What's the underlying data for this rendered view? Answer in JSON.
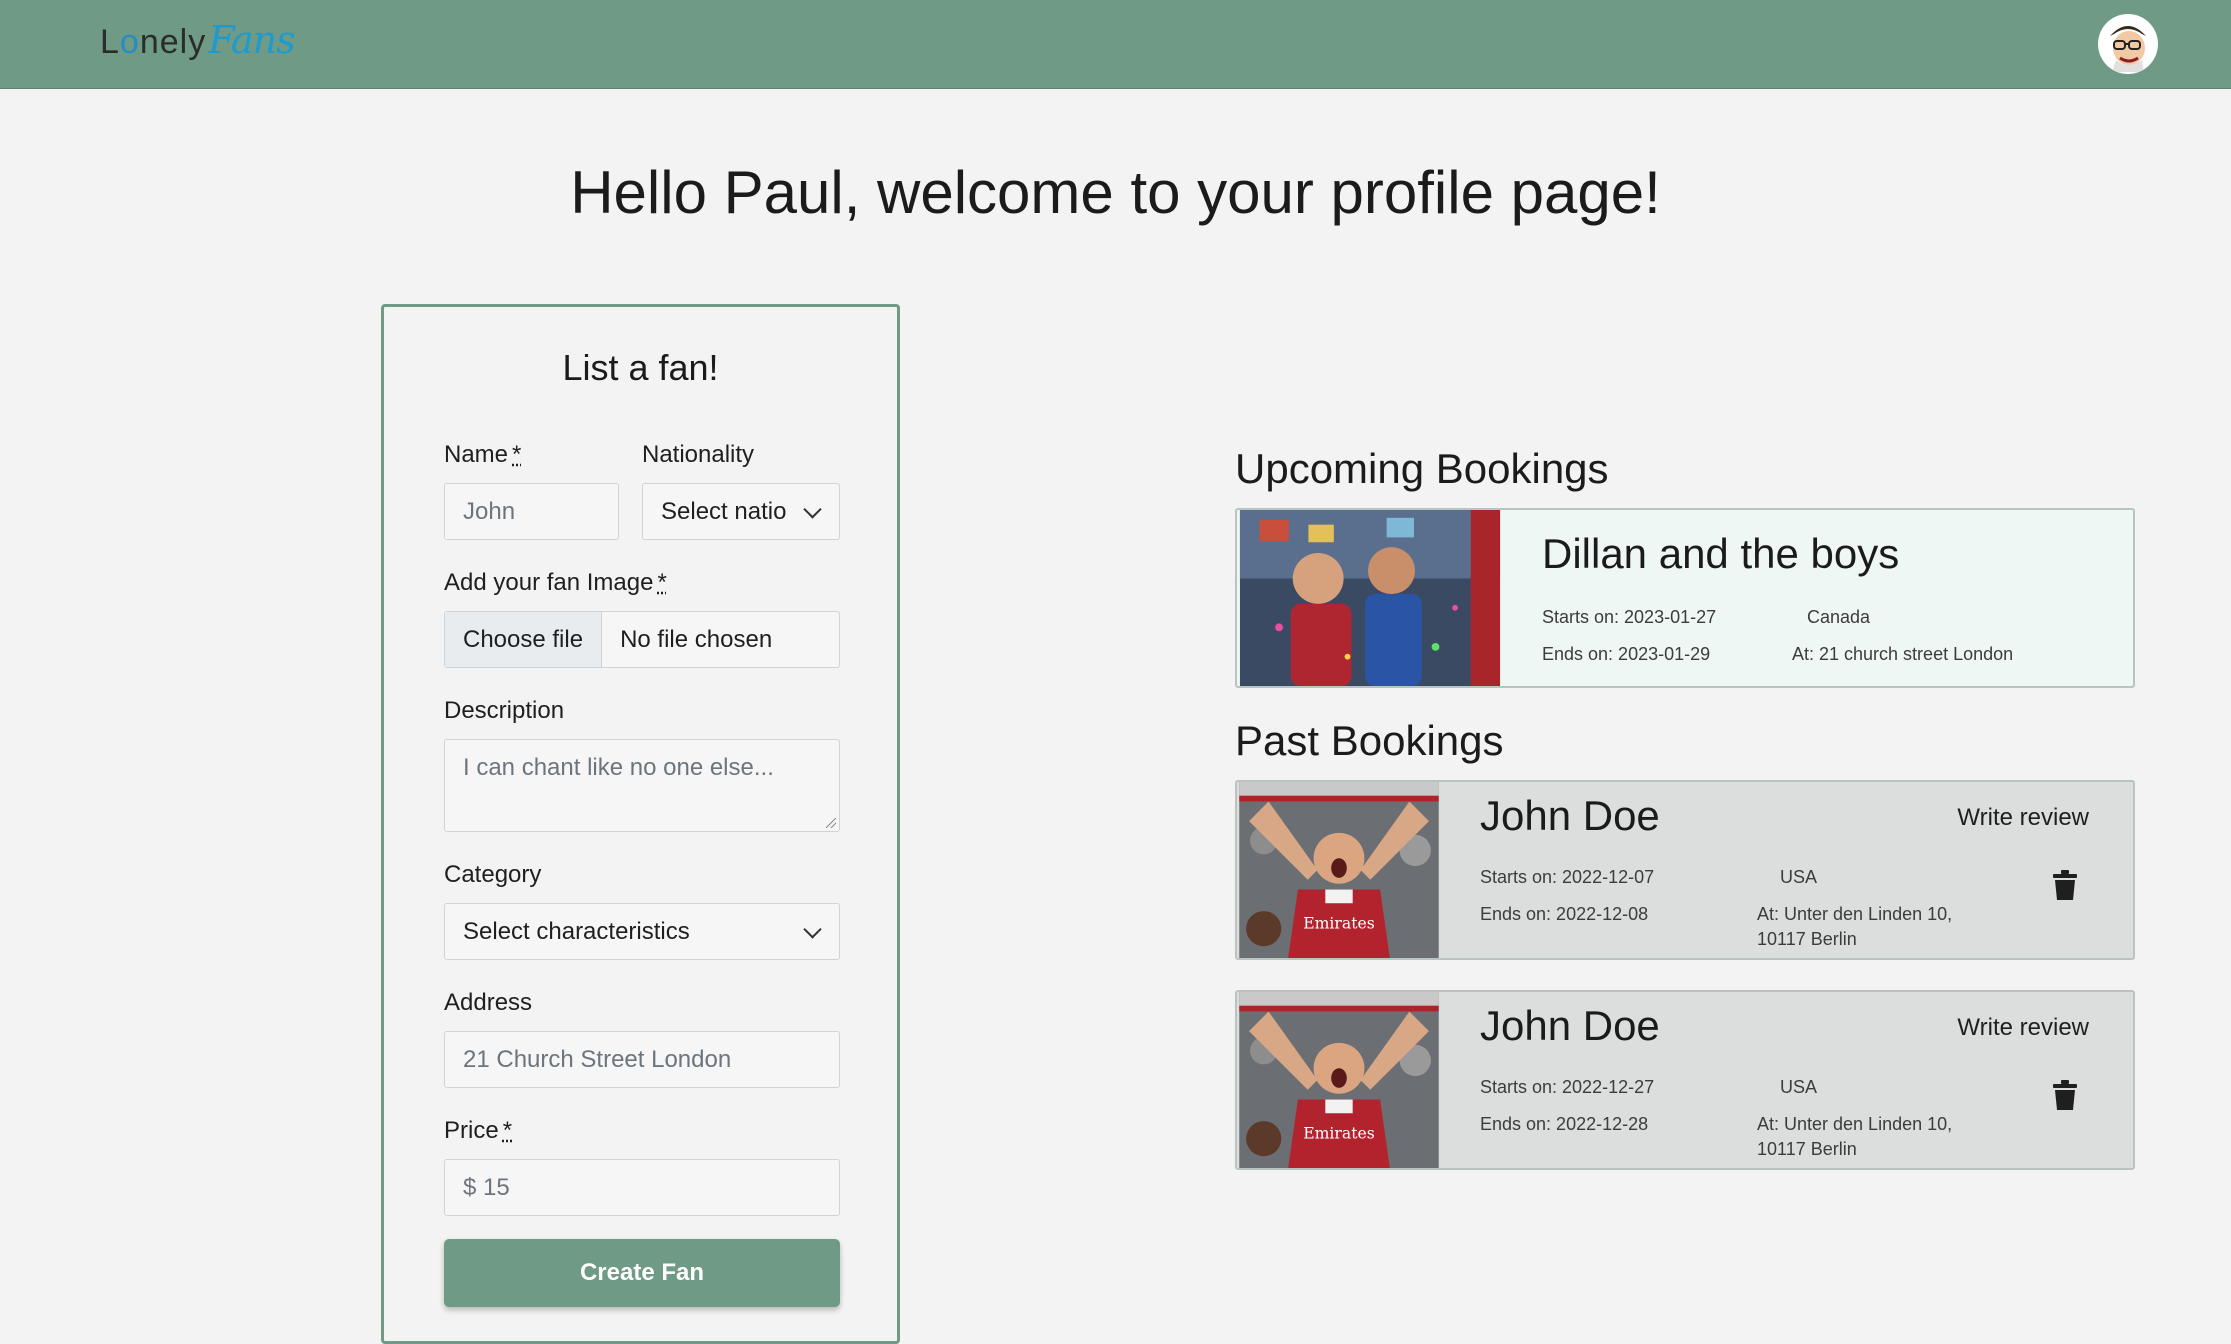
{
  "header": {
    "logo_text_a": "L",
    "logo_text_dot": "o",
    "logo_text_b": "nely",
    "logo_script": "Fans",
    "avatar_icon": "user-avatar-icon"
  },
  "page": {
    "title": "Hello Paul, welcome to your profile page!"
  },
  "form": {
    "title": "List a fan!",
    "name_label": "Name",
    "required_mark": "*",
    "name_placeholder": "John",
    "nationality_label": "Nationality",
    "nationality_value": "Select natio",
    "image_label": "Add your fan Image",
    "choose_file_label": "Choose file",
    "no_file_text": "No file chosen",
    "description_label": "Description",
    "description_placeholder": "I can chant like no one else...",
    "category_label": "Category",
    "category_value": "Select characteristics",
    "address_label": "Address",
    "address_placeholder": "21 Church Street London",
    "price_label": "Price",
    "price_placeholder": "$ 15",
    "submit_label": "Create Fan"
  },
  "upcoming": {
    "title": "Upcoming Bookings",
    "items": [
      {
        "name": "Dillan and the boys",
        "starts": "Starts on: 2023-01-27",
        "ends": "Ends on: 2023-01-29",
        "country": "Canada",
        "address": "At: 21 church street London"
      }
    ]
  },
  "past": {
    "title": "Past Bookings",
    "items": [
      {
        "name": "John Doe",
        "review_label": "Write review",
        "starts": "Starts on: 2022-12-07",
        "ends": "Ends on: 2022-12-08",
        "country": "USA",
        "address_line1": "At: Unter den Linden 10,",
        "address_line2": "10117 Berlin"
      },
      {
        "name": "John Doe",
        "review_label": "Write review",
        "starts": "Starts on: 2022-12-27",
        "ends": "Ends on: 2022-12-28",
        "country": "USA",
        "address_line1": "At: Unter den Linden 10,",
        "address_line2": "10117 Berlin"
      }
    ]
  },
  "colors": {
    "brand": "#6e9a86",
    "upcoming_bg": "#eef7f4",
    "past_bg": "#dbdedd",
    "logo_blue": "#1e9ad0"
  }
}
